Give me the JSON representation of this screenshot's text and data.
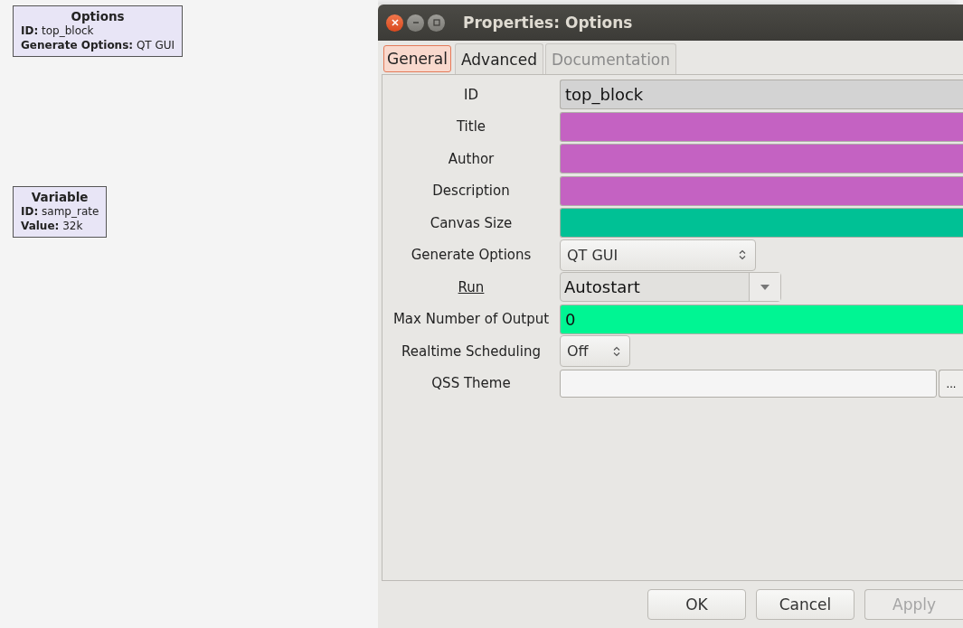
{
  "canvas": {
    "blocks": [
      {
        "title": "Options",
        "lines": [
          {
            "key": "ID:",
            "value": "top_block"
          },
          {
            "key": "Generate Options:",
            "value": "QT GUI"
          }
        ]
      },
      {
        "title": "Variable",
        "lines": [
          {
            "key": "ID:",
            "value": "samp_rate"
          },
          {
            "key": "Value:",
            "value": "32k"
          }
        ]
      }
    ]
  },
  "window": {
    "title": "Properties: Options"
  },
  "tabs": [
    {
      "label": "General",
      "selected": true,
      "disabled": false
    },
    {
      "label": "Advanced",
      "selected": false,
      "disabled": false
    },
    {
      "label": "Documentation",
      "selected": false,
      "disabled": true
    }
  ],
  "params": [
    {
      "label": "ID",
      "underlined": false,
      "kind": "entry",
      "value": "top_block",
      "color": "#d3d3d3"
    },
    {
      "label": "Title",
      "underlined": false,
      "kind": "entry",
      "color": "#c462c2"
    },
    {
      "label": "Author",
      "underlined": false,
      "kind": "entry",
      "color": "#c462c2"
    },
    {
      "label": "Description",
      "underlined": false,
      "kind": "entry",
      "color": "#c462c2"
    },
    {
      "label": "Canvas Size",
      "underlined": false,
      "kind": "entry",
      "color": "#00c195"
    },
    {
      "label": "Generate Options",
      "underlined": false,
      "kind": "spin",
      "value": "QT GUI"
    },
    {
      "label": "Run",
      "underlined": true,
      "kind": "dropdown",
      "value": "Autostart"
    },
    {
      "label": "Max Number of Output",
      "underlined": false,
      "kind": "entry",
      "value": "0",
      "color": "#00f593"
    },
    {
      "label": "Realtime Scheduling",
      "underlined": false,
      "kind": "spin-small",
      "value": "Off"
    },
    {
      "label": "QSS Theme",
      "underlined": false,
      "kind": "file",
      "color": "#f5f5f5",
      "button": "..."
    }
  ],
  "buttons": [
    {
      "label": "OK",
      "disabled": false
    },
    {
      "label": "Cancel",
      "disabled": false
    },
    {
      "label": "Apply",
      "disabled": true
    }
  ]
}
